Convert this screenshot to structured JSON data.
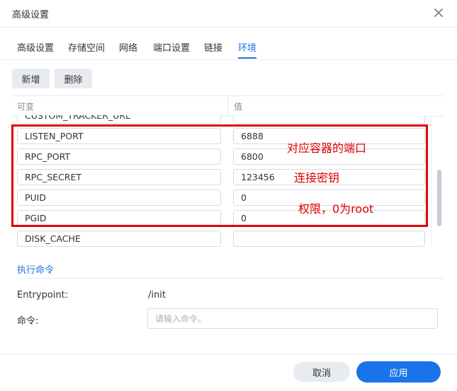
{
  "dialog": {
    "title": "高级设置"
  },
  "tabs": [
    {
      "label": "高级设置"
    },
    {
      "label": "存储空间"
    },
    {
      "label": "网络"
    },
    {
      "label": "端口设置"
    },
    {
      "label": "链接"
    },
    {
      "label": "环境",
      "active": true
    }
  ],
  "toolbar": {
    "add_label": "新增",
    "delete_label": "删除"
  },
  "table": {
    "headers": {
      "key": "可变",
      "value": "值"
    },
    "rows": [
      {
        "key": "CUSTOM_TRACKER_URL",
        "value": ""
      },
      {
        "key": "LISTEN_PORT",
        "value": "6888"
      },
      {
        "key": "RPC_PORT",
        "value": "6800"
      },
      {
        "key": "RPC_SECRET",
        "value": "123456"
      },
      {
        "key": "PUID",
        "value": "0"
      },
      {
        "key": "PGID",
        "value": "0"
      },
      {
        "key": "DISK_CACHE",
        "value": ""
      }
    ]
  },
  "annotations": {
    "port": "对应容器的端口",
    "secret": "连接密钥",
    "permission": "权限，0为root",
    "color": "#e00000"
  },
  "exec": {
    "section_title": "执行命令",
    "entrypoint_label": "Entrypoint:",
    "entrypoint_value": "/init",
    "command_label": "命令:",
    "command_placeholder": "请输入命令。",
    "command_value": ""
  },
  "footer": {
    "cancel_label": "取消",
    "apply_label": "应用"
  },
  "colors": {
    "accent": "#1a73e8",
    "annotation": "#e00000"
  }
}
